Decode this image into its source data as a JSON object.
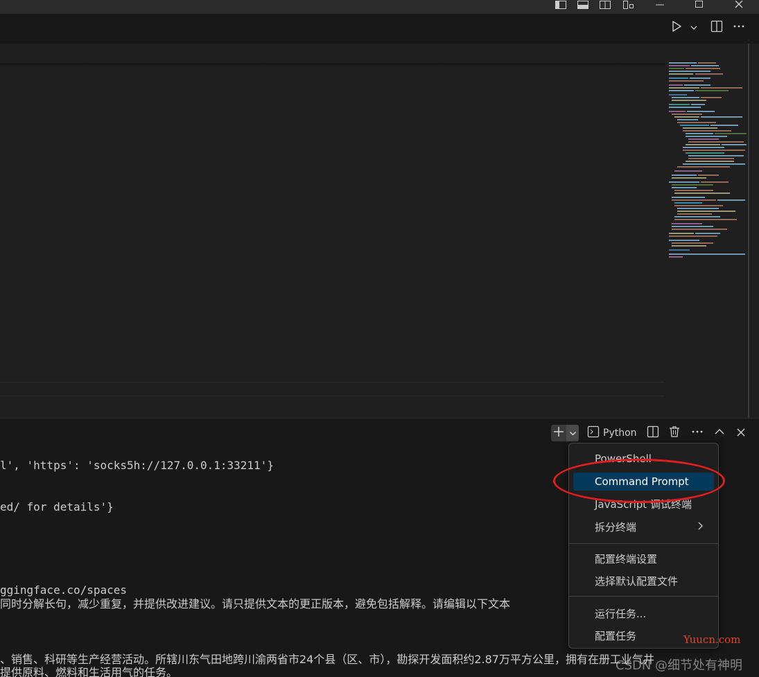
{
  "window": {
    "title_buttons": [
      "toggle-primary-sidebar-icon",
      "toggle-panel-icon",
      "toggle-secondary-sidebar-icon",
      "customize-layout-icon",
      "minimize-icon",
      "maximize-icon",
      "close-window-icon"
    ]
  },
  "editor_toolbar": {
    "icons": [
      "run-icon",
      "run-dropdown-icon",
      "split-editor-icon",
      "more-actions-icon"
    ]
  },
  "terminal_toolbar": {
    "profile_label": "Python",
    "icons": [
      "new-terminal-icon",
      "launch-profile-dropdown-icon",
      "terminal-icon",
      "split-terminal-icon",
      "kill-terminal-icon",
      "more-actions-icon",
      "maximize-panel-icon",
      "close-panel-icon"
    ]
  },
  "terminal": {
    "lines": [
      "l', 'https': 'socks5h://127.0.0.1:33211'}",
      "ed/ for details'}",
      "ggingface.co/spaces",
      "同时分解长句，减少重复，并提供改进建议。请只提供文本的更正版本，避免包括解释。请编辑以下文本",
      "、销售、科研等生产经营活动。所辖川东气田地跨川渝两省市24个县（区、市），勘探开发面积约2.87万平方公里，拥有在册工业气井",
      "提供原料、燃料和生活用气的任务。"
    ]
  },
  "dropdown_menu": {
    "items": [
      {
        "label": "PowerShell"
      },
      {
        "label": "Command Prompt"
      },
      {
        "label": "JavaScript 调试终端"
      },
      {
        "label": "拆分终端"
      },
      {
        "label": "配置终端设置"
      },
      {
        "label": "选择默认配置文件"
      },
      {
        "label": "运行任务..."
      },
      {
        "label": "配置任务"
      }
    ],
    "active_index": 1
  },
  "annotation": {
    "color": "#e01e1e",
    "target": "Command Prompt"
  },
  "watermarks": {
    "site": "Yuucn.com",
    "csdn": "CSDN @细节处有神明"
  },
  "colors": {
    "editor_bg": "#1f1f1f",
    "panel_bg": "#181818",
    "menu_highlight": "#04395e",
    "annotation_red": "#e01e1e"
  }
}
